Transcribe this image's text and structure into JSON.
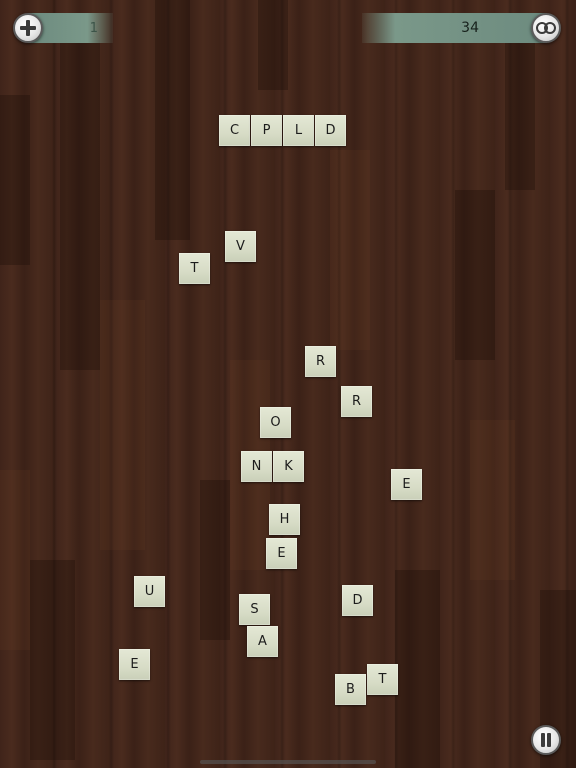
{
  "hud": {
    "left_score": "1",
    "right_score": "34",
    "add_icon": "plus-icon",
    "coop_icon": "linked-rings-icon",
    "pause_icon": "pause-icon"
  },
  "colors": {
    "board_wood": "#3f2418",
    "tile_face": "#d7dcc6",
    "score_bar": "#7a9889",
    "button_face": "#e7e7e7"
  },
  "tiles": [
    {
      "letter": "C"
    },
    {
      "letter": "P"
    },
    {
      "letter": "L"
    },
    {
      "letter": "D"
    },
    {
      "letter": "V"
    },
    {
      "letter": "T"
    },
    {
      "letter": "R"
    },
    {
      "letter": "R"
    },
    {
      "letter": "O"
    },
    {
      "letter": "N"
    },
    {
      "letter": "K"
    },
    {
      "letter": "E"
    },
    {
      "letter": "H"
    },
    {
      "letter": "E"
    },
    {
      "letter": "U"
    },
    {
      "letter": "D"
    },
    {
      "letter": "S"
    },
    {
      "letter": "A"
    },
    {
      "letter": "E"
    },
    {
      "letter": "T"
    },
    {
      "letter": "B"
    }
  ]
}
